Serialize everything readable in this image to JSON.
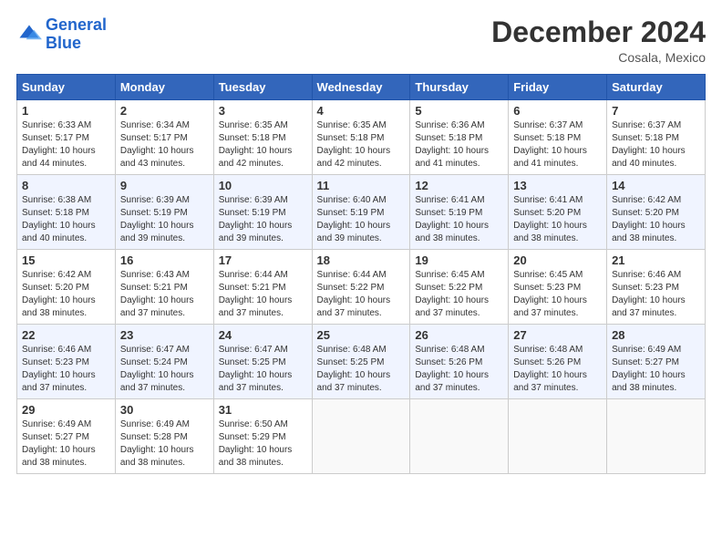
{
  "logo": {
    "line1": "General",
    "line2": "Blue"
  },
  "title": "December 2024",
  "subtitle": "Cosala, Mexico",
  "days_of_week": [
    "Sunday",
    "Monday",
    "Tuesday",
    "Wednesday",
    "Thursday",
    "Friday",
    "Saturday"
  ],
  "weeks": [
    [
      {
        "day": "1",
        "sunrise": "6:33 AM",
        "sunset": "5:17 PM",
        "daylight": "10 hours and 44 minutes."
      },
      {
        "day": "2",
        "sunrise": "6:34 AM",
        "sunset": "5:17 PM",
        "daylight": "10 hours and 43 minutes."
      },
      {
        "day": "3",
        "sunrise": "6:35 AM",
        "sunset": "5:18 PM",
        "daylight": "10 hours and 42 minutes."
      },
      {
        "day": "4",
        "sunrise": "6:35 AM",
        "sunset": "5:18 PM",
        "daylight": "10 hours and 42 minutes."
      },
      {
        "day": "5",
        "sunrise": "6:36 AM",
        "sunset": "5:18 PM",
        "daylight": "10 hours and 41 minutes."
      },
      {
        "day": "6",
        "sunrise": "6:37 AM",
        "sunset": "5:18 PM",
        "daylight": "10 hours and 41 minutes."
      },
      {
        "day": "7",
        "sunrise": "6:37 AM",
        "sunset": "5:18 PM",
        "daylight": "10 hours and 40 minutes."
      }
    ],
    [
      {
        "day": "8",
        "sunrise": "6:38 AM",
        "sunset": "5:18 PM",
        "daylight": "10 hours and 40 minutes."
      },
      {
        "day": "9",
        "sunrise": "6:39 AM",
        "sunset": "5:19 PM",
        "daylight": "10 hours and 39 minutes."
      },
      {
        "day": "10",
        "sunrise": "6:39 AM",
        "sunset": "5:19 PM",
        "daylight": "10 hours and 39 minutes."
      },
      {
        "day": "11",
        "sunrise": "6:40 AM",
        "sunset": "5:19 PM",
        "daylight": "10 hours and 39 minutes."
      },
      {
        "day": "12",
        "sunrise": "6:41 AM",
        "sunset": "5:19 PM",
        "daylight": "10 hours and 38 minutes."
      },
      {
        "day": "13",
        "sunrise": "6:41 AM",
        "sunset": "5:20 PM",
        "daylight": "10 hours and 38 minutes."
      },
      {
        "day": "14",
        "sunrise": "6:42 AM",
        "sunset": "5:20 PM",
        "daylight": "10 hours and 38 minutes."
      }
    ],
    [
      {
        "day": "15",
        "sunrise": "6:42 AM",
        "sunset": "5:20 PM",
        "daylight": "10 hours and 38 minutes."
      },
      {
        "day": "16",
        "sunrise": "6:43 AM",
        "sunset": "5:21 PM",
        "daylight": "10 hours and 37 minutes."
      },
      {
        "day": "17",
        "sunrise": "6:44 AM",
        "sunset": "5:21 PM",
        "daylight": "10 hours and 37 minutes."
      },
      {
        "day": "18",
        "sunrise": "6:44 AM",
        "sunset": "5:22 PM",
        "daylight": "10 hours and 37 minutes."
      },
      {
        "day": "19",
        "sunrise": "6:45 AM",
        "sunset": "5:22 PM",
        "daylight": "10 hours and 37 minutes."
      },
      {
        "day": "20",
        "sunrise": "6:45 AM",
        "sunset": "5:23 PM",
        "daylight": "10 hours and 37 minutes."
      },
      {
        "day": "21",
        "sunrise": "6:46 AM",
        "sunset": "5:23 PM",
        "daylight": "10 hours and 37 minutes."
      }
    ],
    [
      {
        "day": "22",
        "sunrise": "6:46 AM",
        "sunset": "5:23 PM",
        "daylight": "10 hours and 37 minutes."
      },
      {
        "day": "23",
        "sunrise": "6:47 AM",
        "sunset": "5:24 PM",
        "daylight": "10 hours and 37 minutes."
      },
      {
        "day": "24",
        "sunrise": "6:47 AM",
        "sunset": "5:25 PM",
        "daylight": "10 hours and 37 minutes."
      },
      {
        "day": "25",
        "sunrise": "6:48 AM",
        "sunset": "5:25 PM",
        "daylight": "10 hours and 37 minutes."
      },
      {
        "day": "26",
        "sunrise": "6:48 AM",
        "sunset": "5:26 PM",
        "daylight": "10 hours and 37 minutes."
      },
      {
        "day": "27",
        "sunrise": "6:48 AM",
        "sunset": "5:26 PM",
        "daylight": "10 hours and 37 minutes."
      },
      {
        "day": "28",
        "sunrise": "6:49 AM",
        "sunset": "5:27 PM",
        "daylight": "10 hours and 38 minutes."
      }
    ],
    [
      {
        "day": "29",
        "sunrise": "6:49 AM",
        "sunset": "5:27 PM",
        "daylight": "10 hours and 38 minutes."
      },
      {
        "day": "30",
        "sunrise": "6:49 AM",
        "sunset": "5:28 PM",
        "daylight": "10 hours and 38 minutes."
      },
      {
        "day": "31",
        "sunrise": "6:50 AM",
        "sunset": "5:29 PM",
        "daylight": "10 hours and 38 minutes."
      },
      null,
      null,
      null,
      null
    ]
  ]
}
